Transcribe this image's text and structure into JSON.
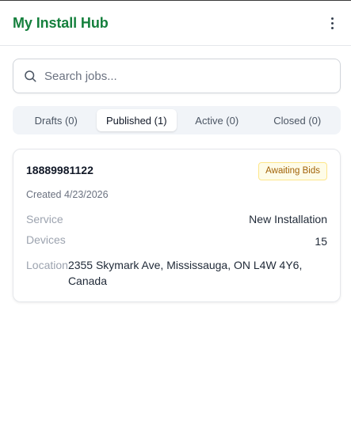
{
  "header": {
    "title": "My Install Hub",
    "menu_icon": "more-vertical-icon"
  },
  "search": {
    "placeholder": "Search jobs...",
    "value": "",
    "icon": "search-icon"
  },
  "tabs": [
    {
      "label": "Drafts (0)",
      "active": false
    },
    {
      "label": "Published (1)",
      "active": true
    },
    {
      "label": "Active (0)",
      "active": false
    },
    {
      "label": "Closed (0)",
      "active": false
    }
  ],
  "jobs": [
    {
      "id": "18889981122",
      "status": "Awaiting Bids",
      "created": "Created 4/23/2026",
      "service_label": "Service",
      "service_value": "New Installation",
      "devices_label": "Devices",
      "devices_value": "15",
      "location_label": "Location",
      "location_value": "2355 Skymark Ave, Mississauga, ON L4W 4Y6, Canada"
    }
  ],
  "colors": {
    "brand": "#15803d",
    "badge_text": "#a16207",
    "badge_bg": "#fefce8",
    "badge_border": "#fde68a"
  }
}
